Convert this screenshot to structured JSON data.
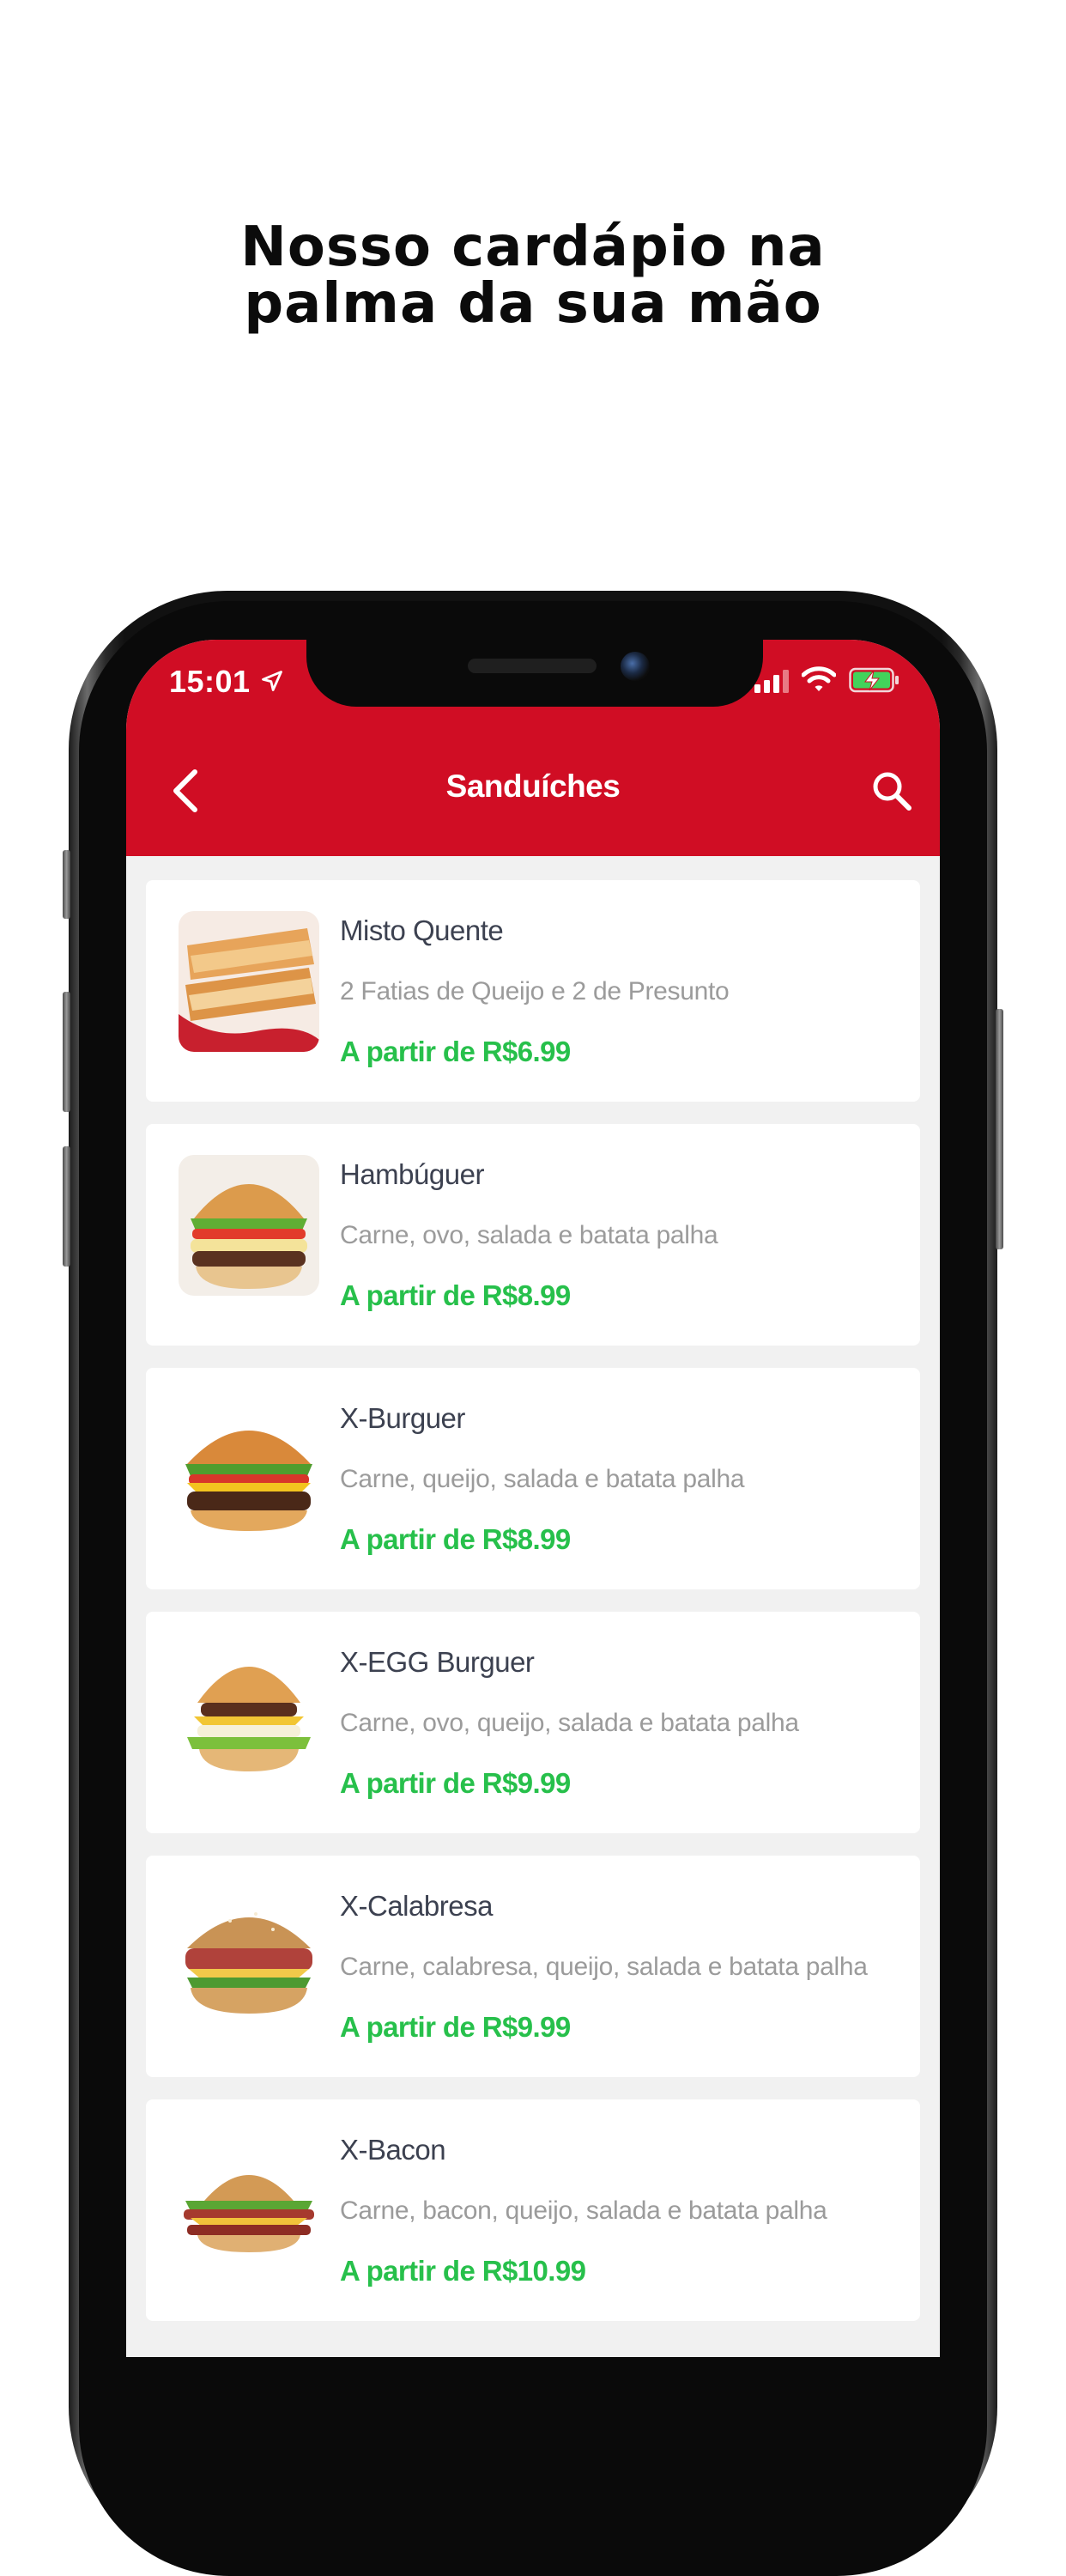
{
  "promo": {
    "headline_line1": "Nosso cardápio na",
    "headline_line2": "palma da sua mão"
  },
  "status_bar": {
    "time": "15:01",
    "icons": [
      "location-arrow-icon",
      "cellular-signal-icon",
      "wifi-icon",
      "battery-charging-icon"
    ]
  },
  "nav": {
    "title": "Sanduíches",
    "back_icon": "chevron-left-icon",
    "search_icon": "search-icon"
  },
  "colors": {
    "header": "#d00d24",
    "price": "#27c04b",
    "name": "#3c4150",
    "description": "#9b9b9b",
    "list_background": "#f1f1f1"
  },
  "menu": {
    "items": [
      {
        "name": "Misto Quente",
        "description": "2 Fatias de Queijo e 2 de Presunto",
        "price": "A partir de R$6.99",
        "image": "toasted-sandwich"
      },
      {
        "name": "Hambúguer",
        "description": "Carne, ovo, salada e batata palha",
        "price": "A partir de R$8.99",
        "image": "hamburger"
      },
      {
        "name": "X-Burguer",
        "description": "Carne, queijo, salada e batata palha",
        "price": "A partir de R$8.99",
        "image": "cheeseburger"
      },
      {
        "name": "X-EGG Burguer",
        "description": "Carne, ovo, queijo, salada e batata palha",
        "price": "A partir de R$9.99",
        "image": "egg-burger"
      },
      {
        "name": "X-Calabresa",
        "description": "Carne, calabresa, queijo, salada e batata palha",
        "price": "A partir de R$9.99",
        "image": "calabresa-burger"
      },
      {
        "name": "X-Bacon",
        "description": "Carne, bacon, queijo, salada e batata palha",
        "price": "A partir de R$10.99",
        "image": "bacon-burger"
      }
    ]
  }
}
